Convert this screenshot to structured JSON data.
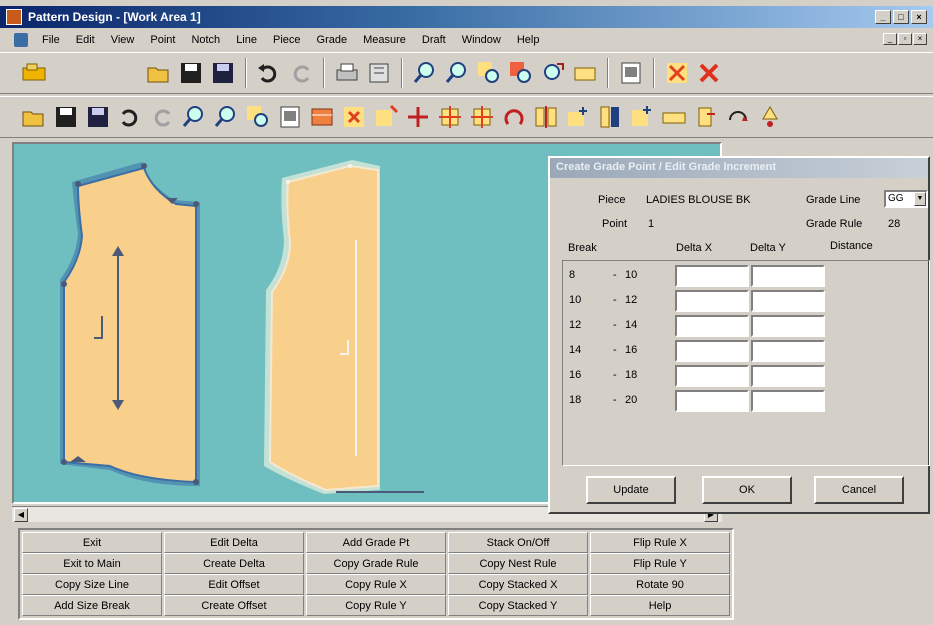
{
  "window": {
    "title": "Pattern Design - [Work Area 1]",
    "min": "_",
    "max": "□",
    "close": "×",
    "mdi_min": "_",
    "mdi_max": "▫",
    "mdi_close": "×"
  },
  "menu": [
    "File",
    "Edit",
    "View",
    "Point",
    "Notch",
    "Line",
    "Piece",
    "Grade",
    "Measure",
    "Draft",
    "Window",
    "Help"
  ],
  "toolbar1": {
    "icons": [
      "piece-icon",
      "open-icon",
      "save-icon",
      "save-as-icon",
      "undo-icon",
      "redo-icon",
      "print-icon",
      "plot-icon",
      "zoom-in-icon",
      "zoom-out-icon",
      "zoom-window-icon",
      "zoom-piece-icon",
      "zoom-full-icon",
      "measure-icon",
      "report-icon",
      "delete-icon",
      "cancel-icon"
    ]
  },
  "toolbar2": {
    "icons": [
      "open-icon",
      "save-icon",
      "save-as-icon",
      "undo-icon",
      "redo-icon",
      "zoom-in-icon",
      "zoom-out-icon",
      "zoom-window-icon",
      "report-icon",
      "table-icon",
      "delete-piece-icon",
      "add-point-icon",
      "cross-icon",
      "grade-point-icon",
      "grade-move-icon",
      "rotate-icon",
      "mirror-icon",
      "notch-icon",
      "split-icon",
      "flag-icon",
      "ruler-icon",
      "move-piece-icon",
      "arrow-curve-icon",
      "pin-icon"
    ]
  },
  "dialog": {
    "title": "Create Grade Point / Edit Grade Increment",
    "piece_label": "Piece",
    "piece_value": "LADIES BLOUSE BK",
    "point_label": "Point",
    "point_value": "1",
    "grade_line_label": "Grade Line",
    "grade_line_value": "GG",
    "grade_rule_label": "Grade Rule",
    "grade_rule_value": "28",
    "col_break": "Break",
    "col_dx": "Delta X",
    "col_dy": "Delta Y",
    "col_distance": "Distance",
    "rows": [
      {
        "from": "8",
        "to": "10"
      },
      {
        "from": "10",
        "to": "12"
      },
      {
        "from": "12",
        "to": "14"
      },
      {
        "from": "14",
        "to": "16"
      },
      {
        "from": "16",
        "to": "18"
      },
      {
        "from": "18",
        "to": "20"
      }
    ],
    "dash": "-",
    "update": "Update",
    "ok": "OK",
    "cancel": "Cancel"
  },
  "commands": [
    [
      "Exit",
      "Exit to Main",
      "Copy Size Line",
      "Add Size Break"
    ],
    [
      "Edit Delta",
      "Create Delta",
      "Edit Offset",
      "Create Offset"
    ],
    [
      "Add Grade Pt",
      "Copy Grade Rule",
      "Copy Rule X",
      "Copy Rule Y"
    ],
    [
      "Stack On/Off",
      "Copy Nest Rule",
      "Copy Stacked X",
      "Copy Stacked Y"
    ],
    [
      "Flip Rule X",
      "Flip Rule Y",
      "Rotate 90",
      "Help"
    ]
  ],
  "colors": {
    "workarea": "#6fbfc0",
    "piece_fill": "#f9cf8c",
    "piece_outline": "#3a6ea5"
  }
}
